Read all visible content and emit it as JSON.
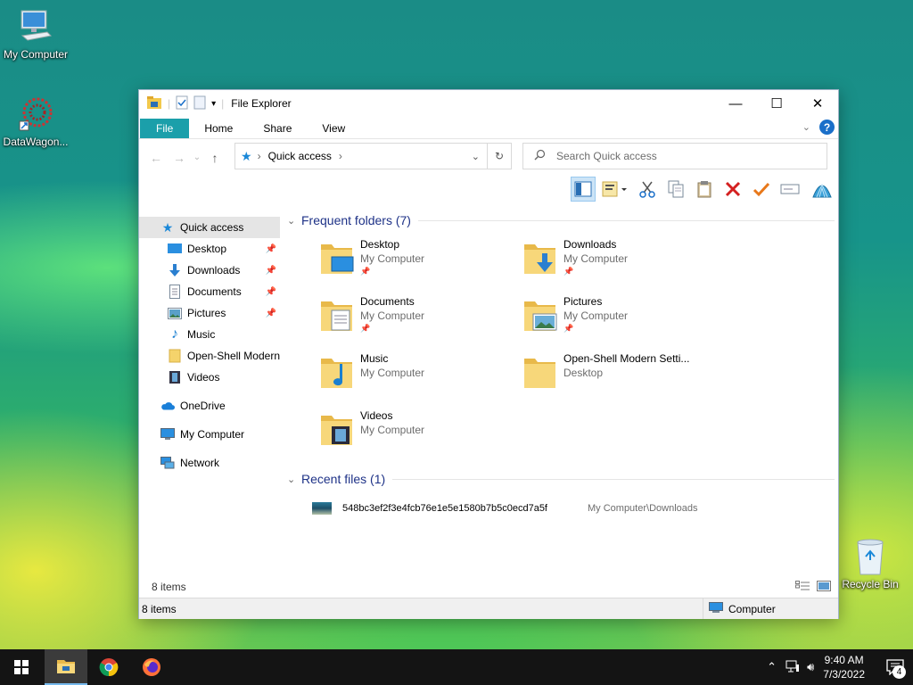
{
  "desktop": {
    "icons": [
      {
        "label": "My Computer"
      },
      {
        "label": "DataWagon..."
      },
      {
        "label": "Recycle Bin"
      }
    ]
  },
  "window": {
    "title": "File Explorer",
    "ribbon_tabs": [
      "File",
      "Home",
      "Share",
      "View"
    ],
    "address": {
      "current": "Quick access"
    },
    "search_placeholder": "Search Quick access"
  },
  "nav": {
    "quick_access": "Quick access",
    "items": [
      {
        "label": "Desktop",
        "pinned": true
      },
      {
        "label": "Downloads",
        "pinned": true
      },
      {
        "label": "Documents",
        "pinned": true
      },
      {
        "label": "Pictures",
        "pinned": true
      },
      {
        "label": "Music",
        "pinned": false
      },
      {
        "label": "Open-Shell Modern",
        "pinned": false
      },
      {
        "label": "Videos",
        "pinned": false
      }
    ],
    "onedrive": "OneDrive",
    "my_computer": "My Computer",
    "network": "Network"
  },
  "frequent": {
    "header": "Frequent folders (7)",
    "folders": [
      {
        "name": "Desktop",
        "location": "My Computer",
        "pinned": true
      },
      {
        "name": "Downloads",
        "location": "My Computer",
        "pinned": true
      },
      {
        "name": "Documents",
        "location": "My Computer",
        "pinned": true
      },
      {
        "name": "Pictures",
        "location": "My Computer",
        "pinned": true
      },
      {
        "name": "Music",
        "location": "My Computer",
        "pinned": false
      },
      {
        "name": "Open-Shell Modern Setti...",
        "location": "Desktop",
        "pinned": false
      },
      {
        "name": "Videos",
        "location": "My Computer",
        "pinned": false
      }
    ]
  },
  "recent": {
    "header": "Recent files (1)",
    "files": [
      {
        "name": "548bc3ef2f3e4fcb76e1e5e1580b7b5c0ecd7a5f",
        "path": "My Computer\\Downloads"
      }
    ]
  },
  "status": {
    "items_count": "8 items",
    "bar_items": "8 items",
    "bar_location": "Computer"
  },
  "taskbar": {
    "time": "9:40 AM",
    "date": "7/3/2022",
    "notification_count": "4"
  },
  "colors": {
    "file_tab": "#1b9faa",
    "group_header": "#1e3287",
    "taskbar": "#141414"
  }
}
